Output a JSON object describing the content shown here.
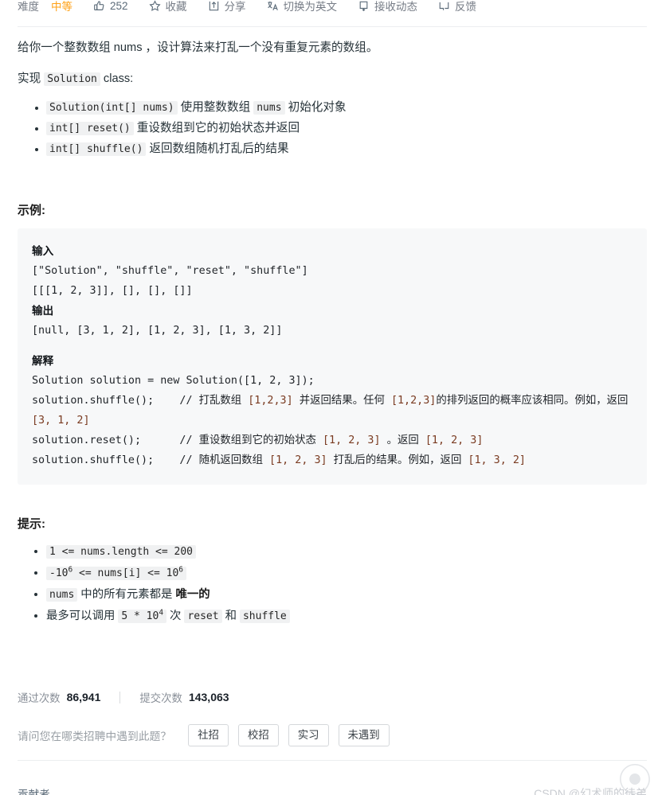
{
  "toolbar": {
    "difficulty_label": "难度",
    "difficulty_value": "中等",
    "like_icon": "thumbs-up-icon",
    "like_count": "252",
    "favorite_icon": "star-icon",
    "favorite_label": "收藏",
    "share_icon": "share-icon",
    "share_label": "分享",
    "translate_icon": "translate-icon",
    "translate_label": "切换为英文",
    "subscribe_icon": "bell-icon",
    "subscribe_label": "接收动态",
    "feedback_icon": "feedback-icon",
    "feedback_label": "反馈"
  },
  "description": {
    "para1": "给你一个整数数组 nums ，设计算法来打乱一个没有重复元素的数组。",
    "para2_prefix": "实现 ",
    "para2_code": "Solution",
    "para2_suffix": " class:",
    "bullets": [
      {
        "code": "Solution(int[] nums)",
        "text_a": " 使用整数数组 ",
        "code2": "nums",
        "text_b": " 初始化对象"
      },
      {
        "code": "int[] reset()",
        "text_a": " 重设数组到它的初始状态并返回",
        "code2": "",
        "text_b": ""
      },
      {
        "code": "int[] shuffle()",
        "text_a": " 返回数组随机打乱后的结果",
        "code2": "",
        "text_b": ""
      }
    ]
  },
  "example": {
    "heading": "示例:",
    "input_label": "输入",
    "input_line1": "[\"Solution\", \"shuffle\", \"reset\", \"shuffle\"]",
    "input_line2": "[[[1, 2, 3]], [], [], []]",
    "output_label": "输出",
    "output_line1": "[null, [3, 1, 2], [1, 2, 3], [1, 3, 2]]",
    "explain_label": "解释",
    "explain_line1": "Solution solution = new Solution([1, 2, 3]);",
    "explain_line2_code": "solution.shuffle();",
    "explain_line2_comment_a": "    // 打乱数组 ",
    "explain_line2_arr1": "[1,2,3]",
    "explain_line2_comment_b": " 并返回结果。任何 ",
    "explain_line2_arr2": "[1,2,3]",
    "explain_line2_comment_c": "的排列返回的概率应该相同。例如，返回 ",
    "explain_line2_arr3": "[3, 1, 2]",
    "explain_line3_code": "solution.reset();",
    "explain_line3_comment_a": "      // 重设数组到它的初始状态 ",
    "explain_line3_arr1": "[1, 2, 3]",
    "explain_line3_comment_b": " 。返回 ",
    "explain_line3_arr2": "[1, 2, 3]",
    "explain_line4_code": "solution.shuffle();",
    "explain_line4_comment_a": "    // 随机返回数组 ",
    "explain_line4_arr1": "[1, 2, 3]",
    "explain_line4_comment_b": " 打乱后的结果。例如，返回 ",
    "explain_line4_arr2": "[1, 3, 2]"
  },
  "hints": {
    "heading": "提示:",
    "item1": "1 <= nums.length <= 200",
    "item2_a": "-10",
    "item2_sup1": "6",
    "item2_b": " <= nums[i] <= 10",
    "item2_sup2": "6",
    "item3_code": "nums",
    "item3_text": " 中的所有元素都是 ",
    "item3_strong": "唯一的",
    "item4_prefix": "最多可以调用 ",
    "item4_code1_a": "5 * 10",
    "item4_code1_sup": "4",
    "item4_mid": " 次 ",
    "item4_code2": "reset",
    "item4_and": " 和 ",
    "item4_code3": "shuffle"
  },
  "stats": {
    "accepted_label": "通过次数",
    "accepted_value": "86,941",
    "submissions_label": "提交次数",
    "submissions_value": "143,063"
  },
  "survey": {
    "question": "请问您在哪类招聘中遇到此题？",
    "buttons": [
      "社招",
      "校招",
      "实习",
      "未遇到"
    ]
  },
  "footer": {
    "contributor_label": "贡献者",
    "watermark": "CSDN @幻术师的徒弟"
  },
  "colors": {
    "difficulty_medium": "#ffa116",
    "code_bg": "#f7f8f9",
    "inline_code_bg": "#f0f1f2",
    "array_token": "#7a3b21",
    "text": "#263238"
  }
}
